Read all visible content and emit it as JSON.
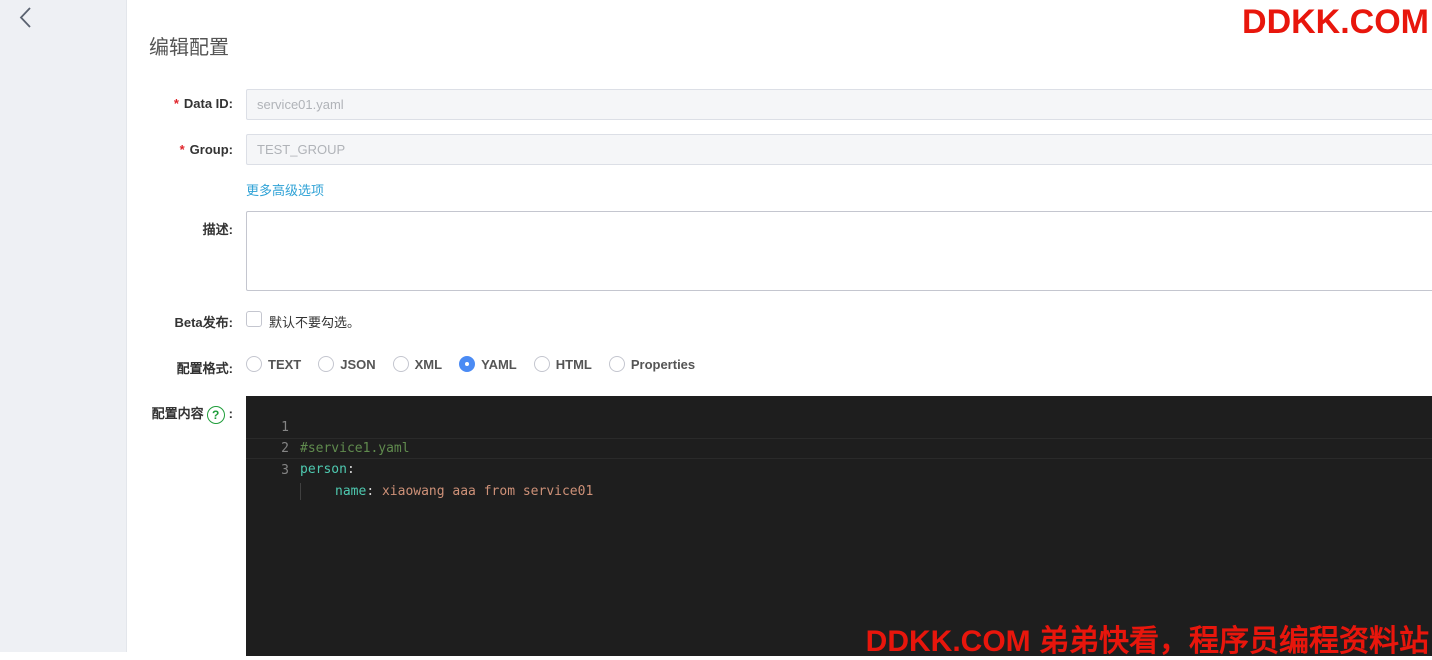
{
  "page": {
    "title": "编辑配置"
  },
  "form": {
    "data_id": {
      "label": "Data ID:",
      "value": "service01.yaml",
      "required_mark": "*"
    },
    "group": {
      "label": "Group:",
      "value": "TEST_GROUP",
      "required_mark": "*"
    },
    "advanced_link": "更多高级选项",
    "description": {
      "label": "描述:",
      "value": ""
    },
    "beta": {
      "label": "Beta发布:",
      "checkbox_label": "默认不要勾选。",
      "checked": false
    },
    "format": {
      "label": "配置格式:",
      "options": [
        "TEXT",
        "JSON",
        "XML",
        "YAML",
        "HTML",
        "Properties"
      ],
      "selected": "YAML"
    },
    "content": {
      "label": "配置内容",
      "help_icon": "question-circle-icon",
      "colon": ":"
    }
  },
  "editor": {
    "lines": [
      {
        "number": "1",
        "comment": "#service1.yaml"
      },
      {
        "number": "2",
        "key": "person",
        "colon": ":"
      },
      {
        "number": "3",
        "key": "name",
        "colon": ":",
        "value": " xiaowang aaa from service01"
      }
    ]
  },
  "watermark": {
    "top": "DDKK.COM",
    "bottom": "DDKK.COM 弟弟快看，程序员编程资料站"
  },
  "colors": {
    "link": "#2fa2d6",
    "radio_selected": "#4b8bf4",
    "required": "#e0242a",
    "help_icon": "#1f9d3a",
    "watermark": "#e8160c",
    "editor_bg": "#1e1e1e"
  }
}
